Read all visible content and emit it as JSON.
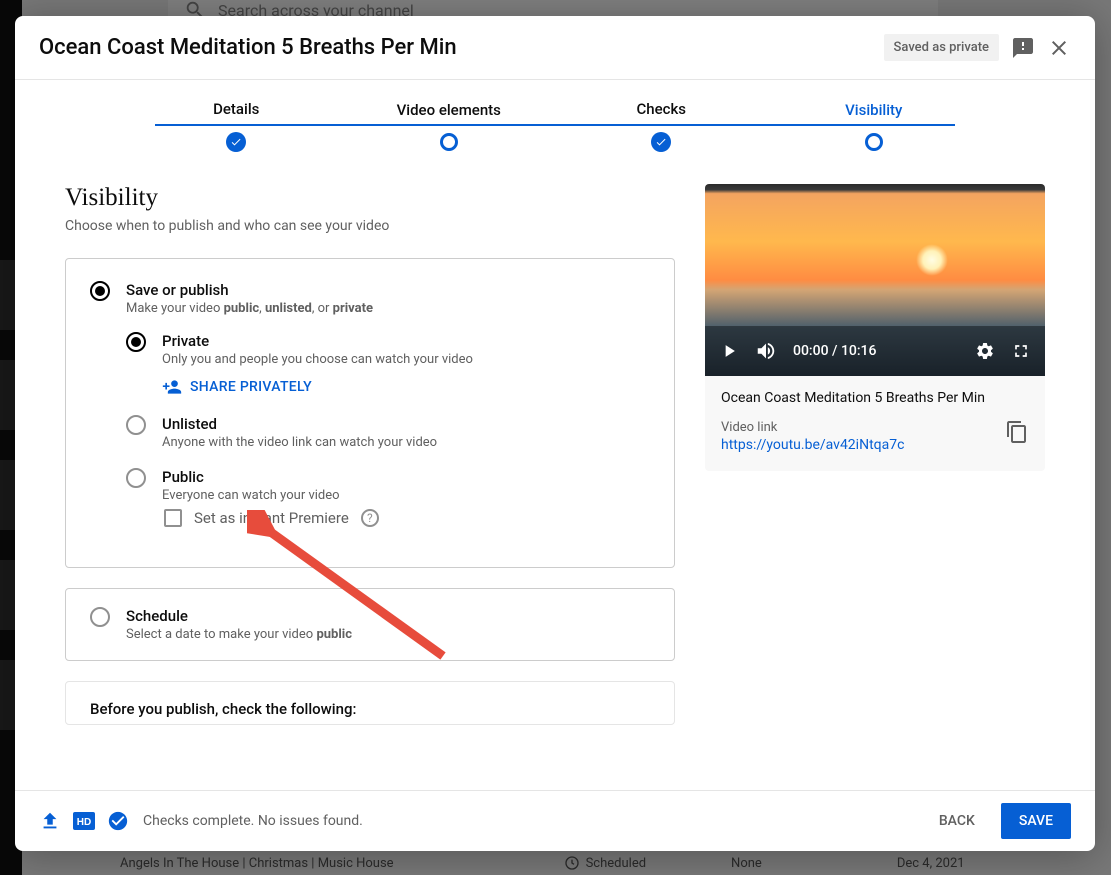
{
  "background": {
    "search_placeholder": "Search across your channel",
    "row_title": "Angels In The House | Christmas | Music House",
    "row_status": "Scheduled",
    "row_restrict": "None",
    "row_date": "Dec 4, 2021"
  },
  "header": {
    "title": "Ocean Coast Meditation 5 Breaths Per Min",
    "saved_badge": "Saved as private"
  },
  "stepper": {
    "details": "Details",
    "elements": "Video elements",
    "checks": "Checks",
    "visibility": "Visibility"
  },
  "visibility": {
    "heading": "Visibility",
    "subheading": "Choose when to publish and who can see your video",
    "save_publish": {
      "title": "Save or publish",
      "desc_a": "Make your video ",
      "desc_b": "public",
      "desc_c": ", ",
      "desc_d": "unlisted",
      "desc_e": ", or ",
      "desc_f": "private"
    },
    "private": {
      "title": "Private",
      "desc": "Only you and people you choose can watch your video",
      "share": "SHARE PRIVATELY"
    },
    "unlisted": {
      "title": "Unlisted",
      "desc": "Anyone with the video link can watch your video"
    },
    "public": {
      "title": "Public",
      "desc": "Everyone can watch your video",
      "premiere": "Set as instant Premiere"
    },
    "schedule": {
      "title": "Schedule",
      "desc_a": "Select a date to make your video ",
      "desc_b": "public"
    },
    "checks_heading": "Before you publish, check the following:"
  },
  "preview": {
    "time": "00:00 / 10:16",
    "title": "Ocean Coast Meditation 5 Breaths Per Min",
    "link_label": "Video link",
    "link": "https://youtu.be/av42iNtqa7c"
  },
  "footer": {
    "status": "Checks complete. No issues found.",
    "back": "BACK",
    "save": "SAVE"
  }
}
